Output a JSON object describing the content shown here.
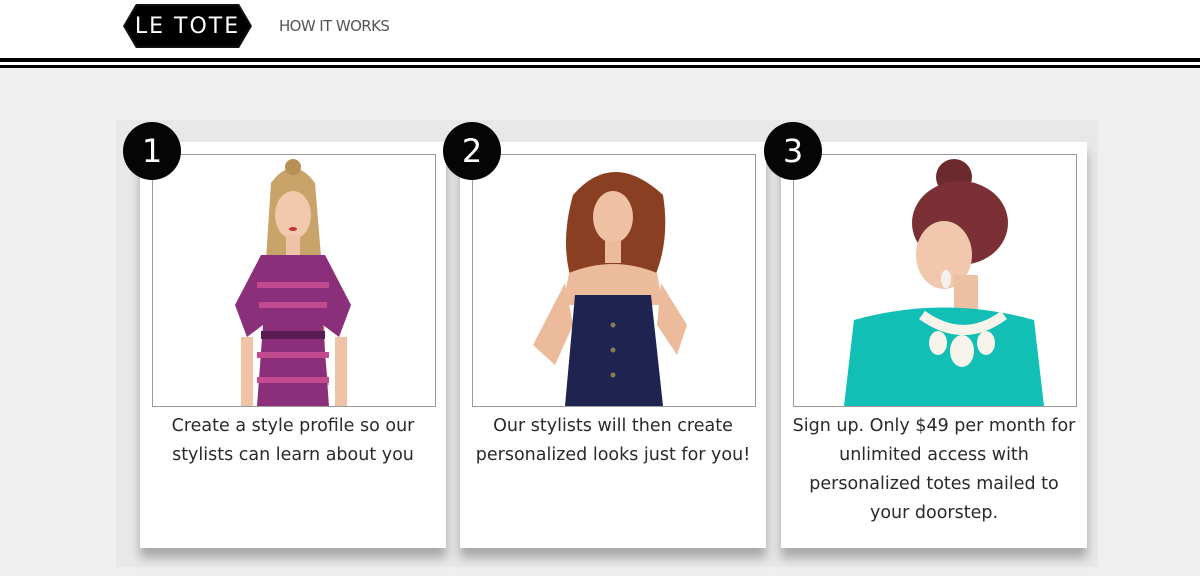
{
  "header": {
    "logo_text": "LE TOTE",
    "nav_link": "HOW IT WORKS"
  },
  "steps": [
    {
      "number": "1",
      "caption": "Create a style profile so our stylists can learn about you",
      "photo": "model-purple-chevron-dress"
    },
    {
      "number": "2",
      "caption": "Our stylists will then create personalized looks just for you!",
      "photo": "model-navy-strapless-dress"
    },
    {
      "number": "3",
      "caption": "Sign up. Only $49 per month for unlimited access with personalized totes mailed to your doorstep.",
      "photo": "model-teal-top-statement-necklace"
    }
  ],
  "colors": {
    "brand_black": "#000000",
    "page_background": "#efefef",
    "dress_purple": "#8b2f7a",
    "dress_navy": "#1f2350",
    "top_teal": "#12bfb4"
  }
}
